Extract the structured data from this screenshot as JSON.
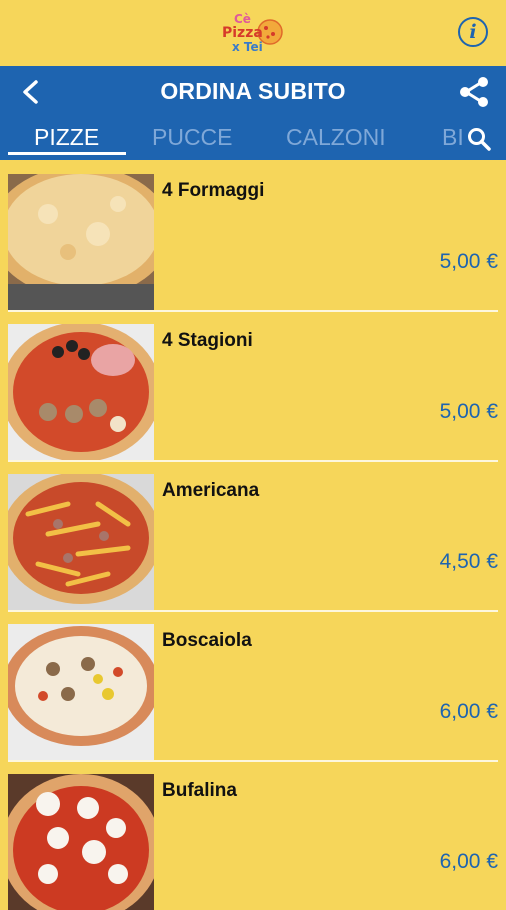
{
  "header": {
    "logo": {
      "line1": "Cè",
      "line2": "Pizza",
      "line3": "x Tei"
    },
    "info_glyph": "i",
    "title": "ORDINA SUBITO"
  },
  "tabs": [
    {
      "label": "PIZZE",
      "active": true
    },
    {
      "label": "PUCCE",
      "active": false
    },
    {
      "label": "CALZONI",
      "active": false
    },
    {
      "label": "BI",
      "active": false
    }
  ],
  "icons": {
    "back": "back-arrow-icon",
    "share": "share-icon",
    "search": "search-icon",
    "info": "info-icon"
  },
  "colors": {
    "background": "#f6d65a",
    "brand_blue": "#1e64b0",
    "tab_inactive": "#7fa8d8",
    "price": "#1e64b0"
  },
  "items": [
    {
      "name": "4 Formaggi",
      "price": "5,00 €",
      "thumb": "4 Formaggi pizza photo"
    },
    {
      "name": "4 Stagioni",
      "price": "5,00 €",
      "thumb": "4 Stagioni pizza photo"
    },
    {
      "name": "Americana",
      "price": "4,50 €",
      "thumb": "Americana pizza photo"
    },
    {
      "name": "Boscaiola",
      "price": "6,00 €",
      "thumb": "Boscaiola pizza photo"
    },
    {
      "name": "Bufalina",
      "price": "6,00 €",
      "thumb": "Bufalina pizza photo"
    }
  ]
}
